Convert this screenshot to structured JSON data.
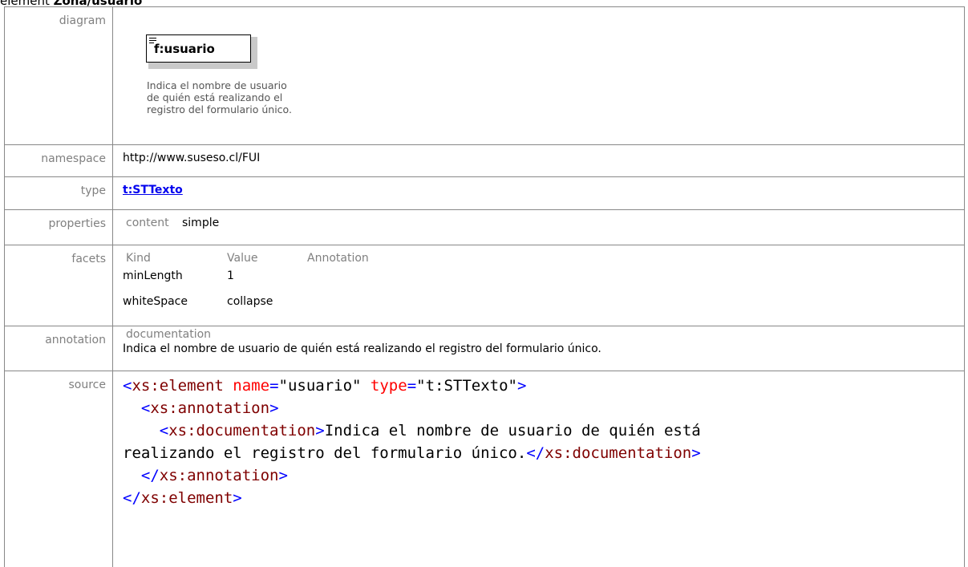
{
  "header": {
    "prefix": "element ",
    "path": "Zona/usuario"
  },
  "rows": {
    "diagram": {
      "label": "diagram",
      "element_name": "f:usuario",
      "doc_lines": [
        "Indica el nombre de usuario",
        "de quién está realizando el",
        "registro del formulario único."
      ]
    },
    "namespace": {
      "label": "namespace",
      "value": "http://www.suseso.cl/FUI"
    },
    "type": {
      "label": "type",
      "value": "t:STTexto"
    },
    "properties": {
      "label": "properties",
      "key": "content",
      "value": "simple"
    },
    "facets": {
      "label": "facets",
      "headers": [
        "Kind",
        "Value",
        "Annotation"
      ],
      "items": [
        {
          "kind": "minLength",
          "value": "1"
        },
        {
          "kind": "whiteSpace",
          "value": "collapse"
        }
      ]
    },
    "annotation": {
      "label": "annotation",
      "head": "documentation",
      "text": "Indica el nombre de usuario de quién está realizando el registro del formulario único."
    },
    "source": {
      "label": "source",
      "tag_element": "xs:element",
      "attr_name": "name",
      "attr_name_val": "\"usuario\"",
      "attr_type": "type",
      "attr_type_val": "\"t:STTexto\"",
      "tag_annotation": "xs:annotation",
      "tag_documentation": "xs:documentation",
      "doc_text_1": "Indica el nombre de usuario de quién está",
      "doc_text_2": "realizando el registro del formulario único."
    }
  }
}
